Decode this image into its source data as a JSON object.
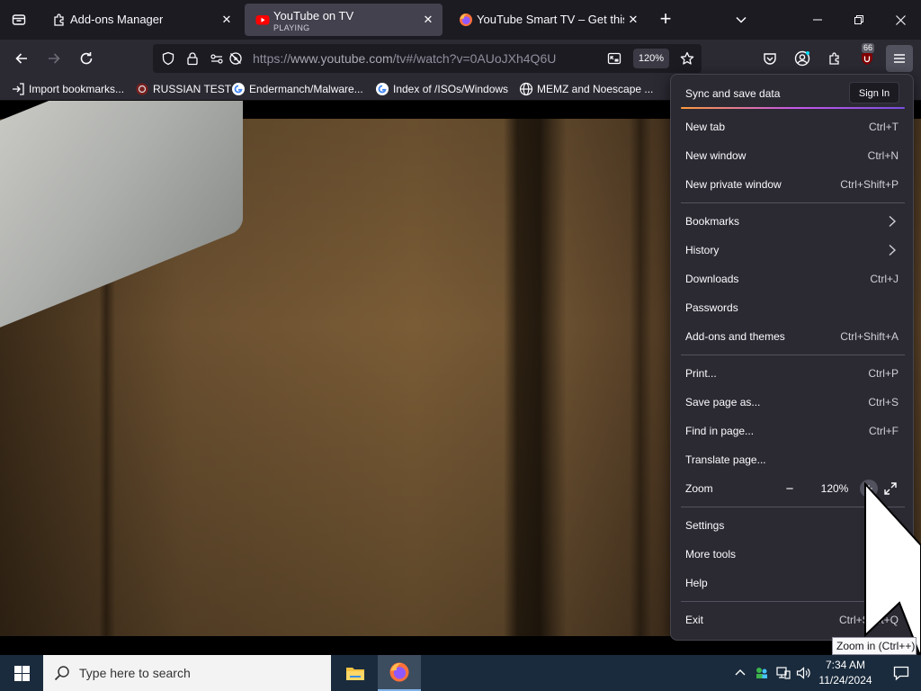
{
  "tabs": [
    {
      "label": "Add-ons Manager",
      "icon": "puzzle-icon"
    },
    {
      "label": "YouTube on TV",
      "sublabel": "PLAYING",
      "icon": "youtube-icon",
      "active": true
    },
    {
      "label": "YouTube Smart TV – Get this Extension for Firefox",
      "icon": "firefox-icon"
    }
  ],
  "urlbar": {
    "scheme": "https://",
    "host": "www.youtube.com",
    "path": "/tv#/watch?v=0AUoJXh4Q6U",
    "zoom": "120%"
  },
  "extension_badge": "66",
  "bookmarks": [
    {
      "label": "Import bookmarks...",
      "icon": "import-icon"
    },
    {
      "label": "RUSSIAN TEST",
      "icon": "site-icon"
    },
    {
      "label": "Endermanch/Malware...",
      "icon": "google-icon"
    },
    {
      "label": "Index of /ISOs/Windows",
      "icon": "google-icon"
    },
    {
      "label": "MEMZ and Noescape ...",
      "icon": "globe-icon"
    }
  ],
  "menu": {
    "sync_label": "Sync and save data",
    "signin_label": "Sign In",
    "items": [
      {
        "label": "New tab",
        "shortcut": "Ctrl+T"
      },
      {
        "label": "New window",
        "shortcut": "Ctrl+N"
      },
      {
        "label": "New private window",
        "shortcut": "Ctrl+Shift+P"
      },
      {
        "label": "Bookmarks",
        "shortcut": ""
      },
      {
        "label": "History",
        "shortcut": ""
      },
      {
        "label": "Downloads",
        "shortcut": "Ctrl+J"
      },
      {
        "label": "Passwords",
        "shortcut": ""
      },
      {
        "label": "Add-ons and themes",
        "shortcut": "Ctrl+Shift+A"
      },
      {
        "label": "Print...",
        "shortcut": "Ctrl+P"
      },
      {
        "label": "Save page as...",
        "shortcut": "Ctrl+S"
      },
      {
        "label": "Find in page...",
        "shortcut": "Ctrl+F"
      },
      {
        "label": "Translate page...",
        "shortcut": ""
      },
      {
        "label": "Zoom",
        "shortcut": ""
      },
      {
        "label": "Settings",
        "shortcut": ""
      },
      {
        "label": "More tools",
        "shortcut": ""
      },
      {
        "label": "Help",
        "shortcut": ""
      },
      {
        "label": "Exit",
        "shortcut": "Ctrl+Shift+Q"
      }
    ],
    "zoom_value": "120%"
  },
  "tooltip": "Zoom in (Ctrl++)",
  "taskbar": {
    "search_placeholder": "Type here to search",
    "time": "7:34 AM",
    "date": "11/24/2024"
  },
  "colors": {
    "accent": "#7fb2e8",
    "panel_bg": "#2b2a33",
    "tabstrip_bg": "#1c1b22",
    "youtube_red": "#ff0000"
  }
}
